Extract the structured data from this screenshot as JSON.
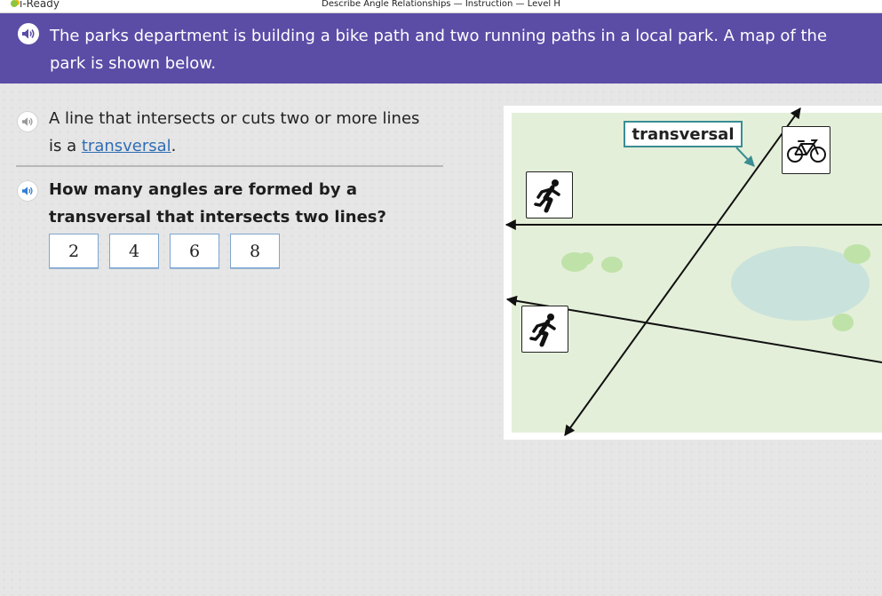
{
  "app": {
    "logo_text": "i-Ready",
    "lesson_title": "Describe Angle Relationships — Instruction — Level H"
  },
  "prompt": {
    "text": "The parks department is building a bike path and two running paths in a local park. A map of the park is shown below.",
    "speaker_icon": "speaker-icon"
  },
  "definition": {
    "text_before": "A line that intersects or cuts two or more lines is a ",
    "link_text": "transversal",
    "text_after": "."
  },
  "question": {
    "text": "How many angles are formed by a transversal that intersects two lines?",
    "answers": [
      "2",
      "4",
      "6",
      "8"
    ]
  },
  "map": {
    "callout_label": "transversal",
    "icons": [
      "runner-icon",
      "runner-icon",
      "bicycle-icon"
    ]
  },
  "colors": {
    "banner": "#5b4ca6",
    "map_background": "#e4efd9",
    "pond": "#c9e3dc",
    "bushes": "#bfe2a8",
    "callout_border": "#3a8d93",
    "link": "#2f6db5",
    "answer_border": "#7ea6cf"
  }
}
